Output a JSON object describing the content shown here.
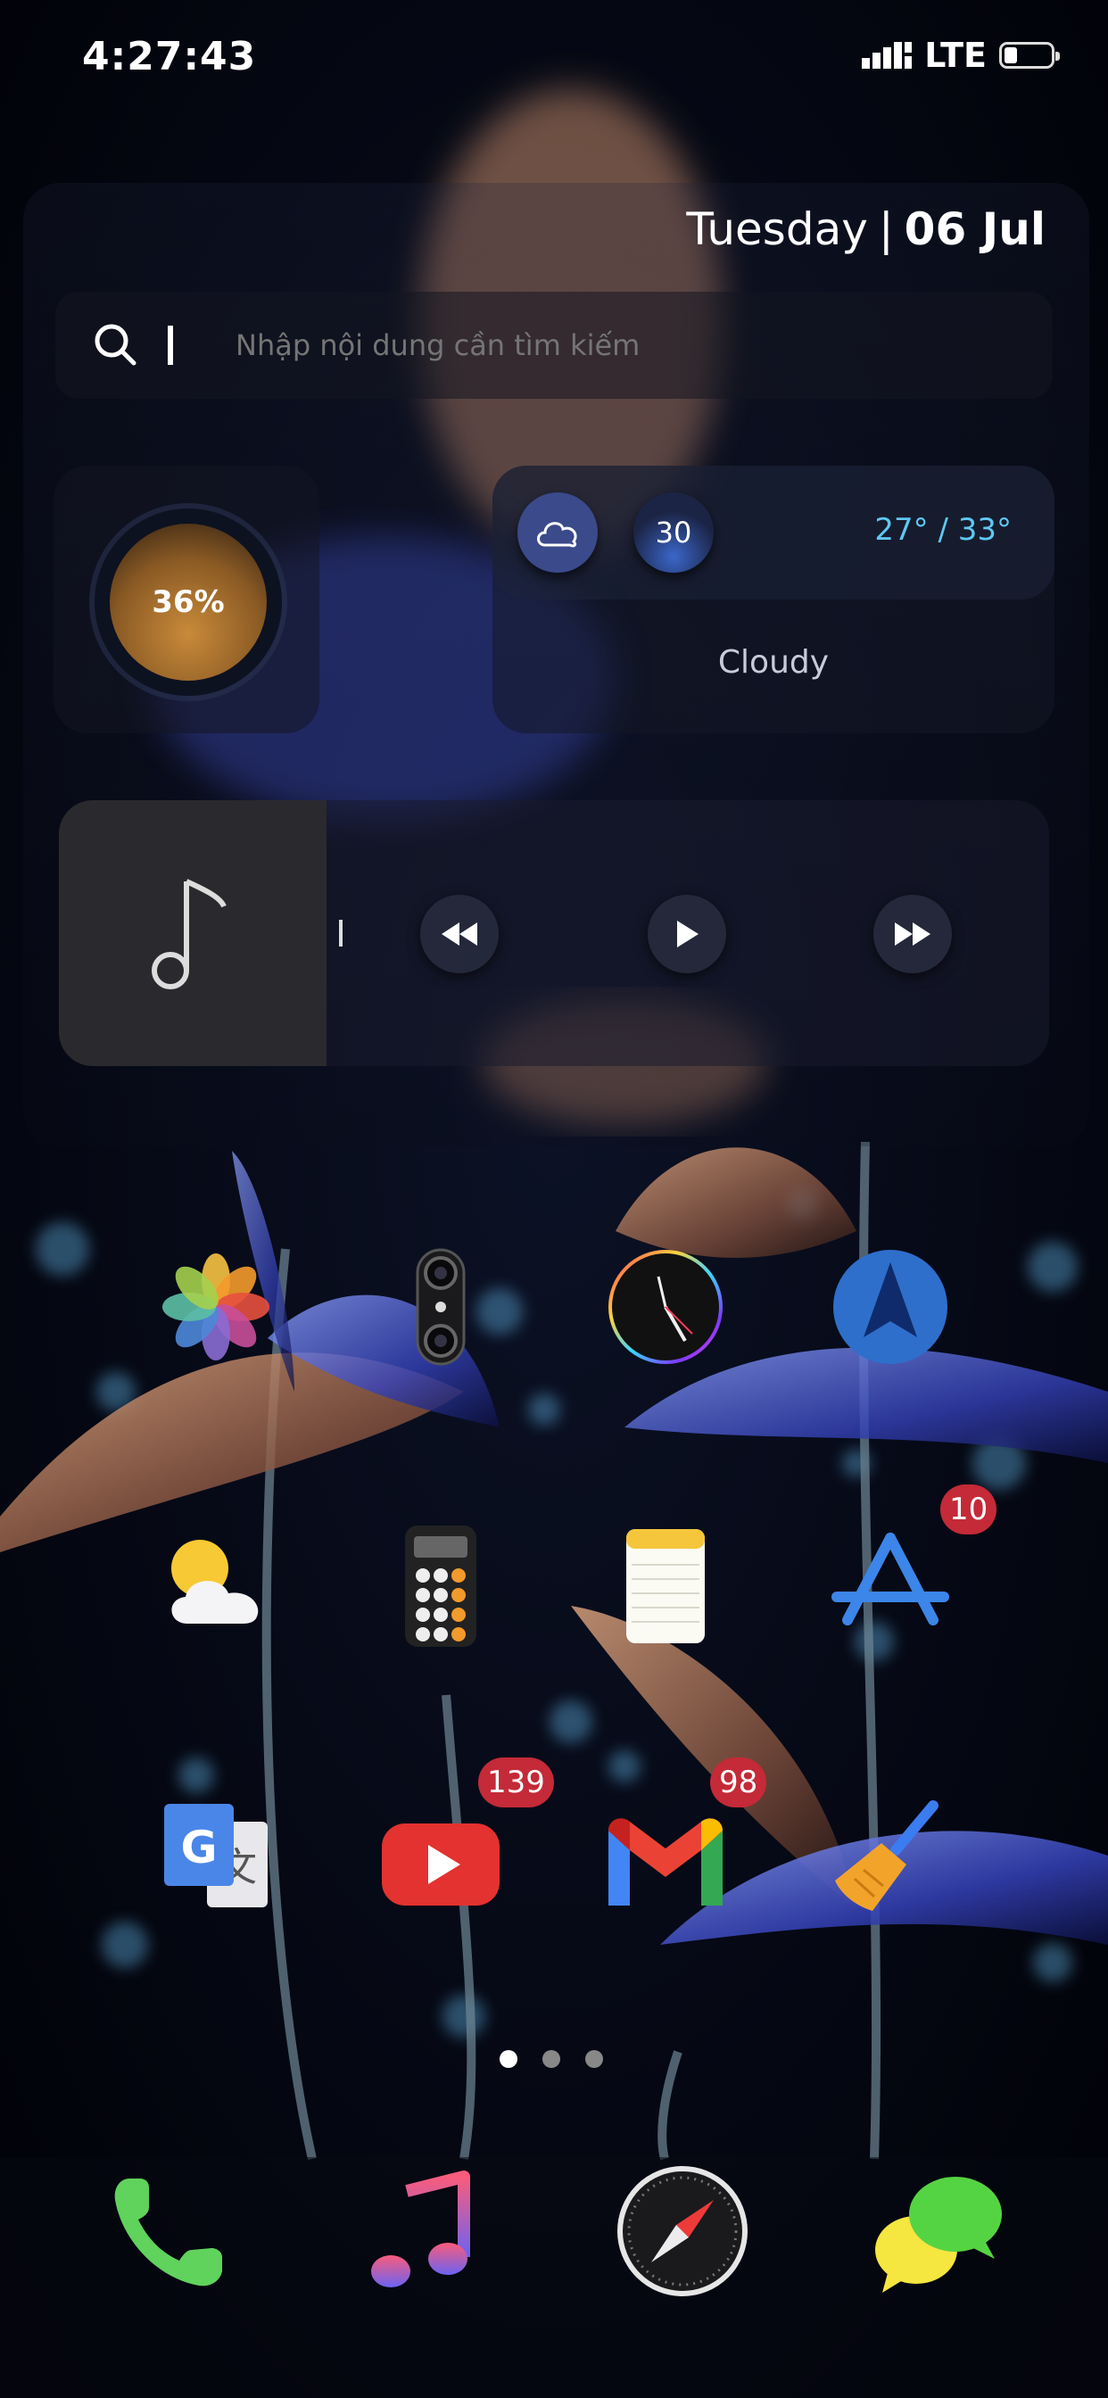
{
  "status_bar": {
    "time": "4:27:43",
    "network": "LTE"
  },
  "widgets": {
    "date": {
      "day": "Tuesday",
      "separator": "|",
      "date": "06 Jul"
    },
    "search": {
      "placeholder": "Nhập nội dung cần tìm kiếm"
    },
    "battery": {
      "percent_label": "36%",
      "level": 0.36
    },
    "weather": {
      "number": "30",
      "range": "27° / 33°",
      "condition": "Cloudy"
    },
    "music": {
      "progress": 0
    }
  },
  "apps": [
    {
      "name": "photos-app-icon"
    },
    {
      "name": "camera-app-icon"
    },
    {
      "name": "clock-app-icon"
    },
    {
      "name": "maps-app-icon"
    },
    {
      "name": "weather-app-icon"
    },
    {
      "name": "calculator-app-icon"
    },
    {
      "name": "notes-app-icon"
    },
    {
      "name": "app-store-app-icon",
      "badge": "10"
    },
    {
      "name": "google-translate-app-icon"
    },
    {
      "name": "youtube-app-icon",
      "badge": "139"
    },
    {
      "name": "gmail-app-icon",
      "badge": "98"
    },
    {
      "name": "cleaner-app-icon"
    }
  ],
  "page_indicator": {
    "pages": 3,
    "current": 1
  },
  "dock": [
    "phone-app-icon",
    "music-app-icon",
    "safari-app-icon",
    "messages-app-icon"
  ],
  "colors": {
    "weather_range": "#5fc8f4",
    "badge": "#c42a37",
    "phone_green": "#5fd35b"
  }
}
